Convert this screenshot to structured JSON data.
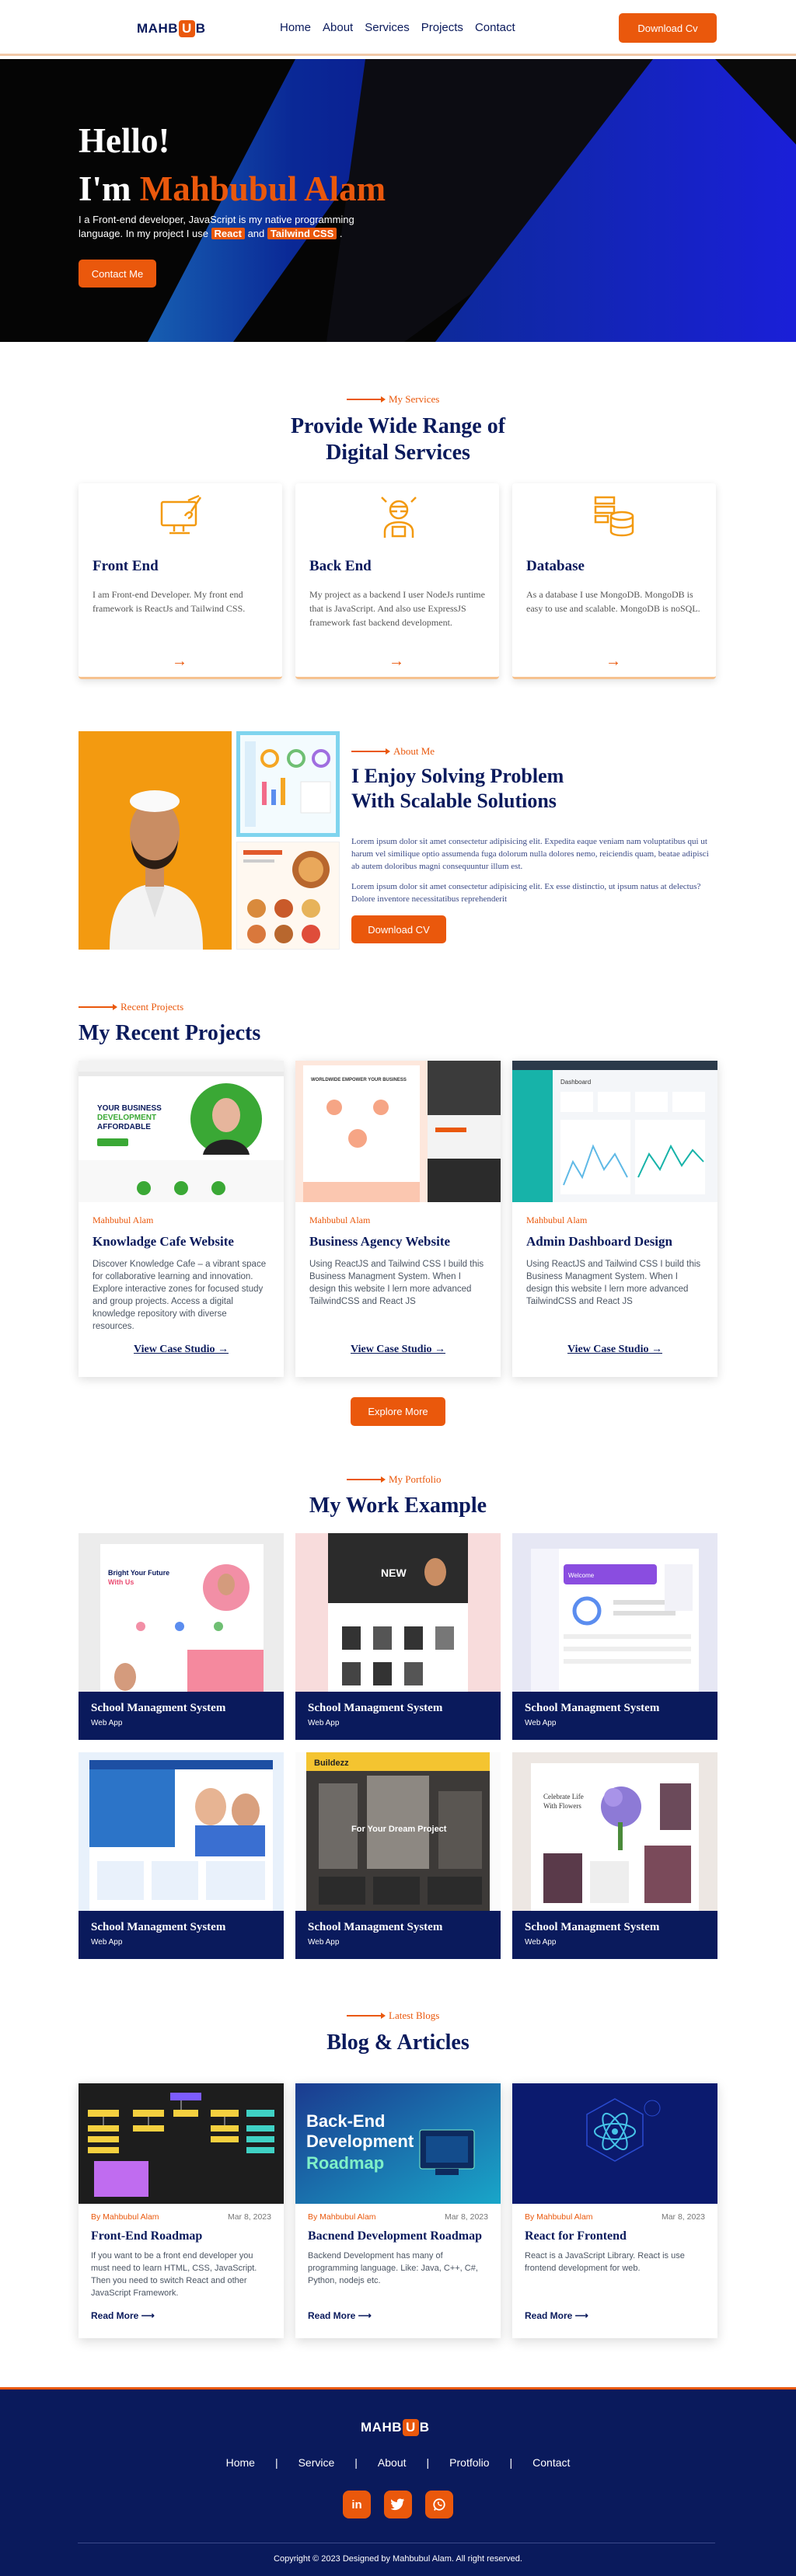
{
  "nav": {
    "logo_pre": "MAHB",
    "logo_mid": "U",
    "logo_post": "B",
    "items": [
      "Home",
      "About",
      "Services",
      "Projects",
      "Contact"
    ],
    "cv_button": "Download Cv"
  },
  "hero": {
    "line1": "Hello!",
    "line2_prefix": "I'm ",
    "name": "Mahbubul Alam",
    "desc_a": "I a Front-end developer, JavaScript is my native programming language. In my project I use ",
    "tag1": "React",
    "desc_and": " and ",
    "tag2": "Tailwind CSS",
    "desc_end": " .",
    "contact_button": "Contact Me"
  },
  "services": {
    "kicker": "My Services",
    "title_line1": "Provide Wide Range of",
    "title_line2": "Digital Services",
    "cards": [
      {
        "title": "Front End",
        "text": "I am Front-end Developer. My front end framework is ReactJs and Tailwind CSS.",
        "icon": "monitor-brush-icon"
      },
      {
        "title": "Back End",
        "text": "My project as a backend I user NodeJs runtime that is JavaScript. And also use ExpressJS framework fast backend development.",
        "icon": "developer-icon"
      },
      {
        "title": "Database",
        "text": "As a database I use MongoDB. MongoDB is easy to use and scalable. MongoDB is noSQL.",
        "icon": "database-icon"
      }
    ],
    "arrow": "→"
  },
  "about": {
    "kicker": "About Me",
    "title_line1": "I Enjoy Solving Problem",
    "title_line2": "With Scalable Solutions",
    "p1": "Lorem ipsum dolor sit amet consectetur adipisicing elit. Expedita eaque veniam nam voluptatibus qui ut harum vel similique optio assumenda fuga dolorum nulla dolores nemo, reiciendis quam, beatae adipisci ab autem doloribus magni consequuntur illum est.",
    "p2": "Lorem ipsum dolor sit amet consectetur adipisicing elit. Ex esse distinctio, ut ipsum natus at delectus? Dolore inventore necessitatibus reprehenderit",
    "cv_button": "Download CV"
  },
  "projects": {
    "kicker": "Recent Projects",
    "title": "My Recent Projects",
    "items": [
      {
        "by": "Mahbubul Alam",
        "title": "Knowladge Cafe Website",
        "text": "Discover Knowledge Cafe – a vibrant space for collaborative learning and innovation. Explore interactive zones for focused study and group projects. Access a digital knowledge repository with diverse resources.",
        "link": "View Case Studio →",
        "shot_heading": "YOUR BUSINESS DEVELOPMENT AFFORDABLE"
      },
      {
        "by": "Mahbubul Alam",
        "title": "Business Agency Website",
        "text": "Using ReactJS and Tailwind CSS I build this Business Managment System. When I design this website I lern more advanced TailwindCSS and React JS",
        "link": "View Case Studio →",
        "shot_heading": "WORLDWIDE EMPOWER YOUR BUSINESS WITH OUR SERVICES"
      },
      {
        "by": "Mahbubul Alam",
        "title": "Admin Dashboard Design",
        "text": "Using ReactJS and Tailwind CSS I build this Business Managment System. When I design this website I lern more advanced TailwindCSS and React JS",
        "link": "View Case Studio →",
        "shot_heading": "Dashboard"
      }
    ],
    "explore_button": "Explore More"
  },
  "portfolio": {
    "kicker": "My Portfolio",
    "title": "My Work Example",
    "items": [
      {
        "title": "School Managment System",
        "sub": "Web App",
        "shot_text": "Bright Your Future With Us"
      },
      {
        "title": "School Managment System",
        "sub": "Web App",
        "shot_text": "NEW"
      },
      {
        "title": "School Managment System",
        "sub": "Web App",
        "shot_text": "Welcome"
      },
      {
        "title": "School Managment System",
        "sub": "Web App",
        "shot_text": ""
      },
      {
        "title": "School Managment System",
        "sub": "Web App",
        "shot_text": "For Your Dream Project"
      },
      {
        "title": "School Managment System",
        "sub": "Web App",
        "shot_text": "Celebrate Life With Flowers"
      }
    ]
  },
  "blogs": {
    "kicker": "Latest Blogs",
    "title": "Blog & Articles",
    "items": [
      {
        "by": "By Mahbubul Alam",
        "date": "Mar 8, 2023",
        "title": "Front-End Roadmap",
        "text": "If you want to be a front end developer you must need to learn HTML, CSS, JavaScript. Then you need to switch React and other JavaScript Framework.",
        "link": "Read More ⟶"
      },
      {
        "by": "By Mahbubul Alam",
        "date": "Mar 8, 2023",
        "title": "Bacnend Development Roadmap",
        "text": "Backend Development has many of programming language. Like: Java, C++, C#, Python, nodejs etc.",
        "link": "Read More ⟶",
        "shot_text1": "Back-End",
        "shot_text2": "Development",
        "shot_text3": "Roadmap"
      },
      {
        "by": "By Mahbubul Alam",
        "date": "Mar 8, 2023",
        "title": "React for Frontend",
        "text": "React is a JavaScript Library. React is use frontend development for web.",
        "link": "Read More ⟶"
      }
    ]
  },
  "footer": {
    "nav": [
      "Home",
      "Service",
      "About",
      "Protfolio",
      "Contact"
    ],
    "sep": "|",
    "social": [
      {
        "label": "in",
        "icon": "linkedin-icon"
      },
      {
        "label": "t",
        "icon": "twitter-icon"
      },
      {
        "label": "w",
        "icon": "whatsapp-icon"
      }
    ],
    "copyright": "Copyright © 2023 Designed by Mahbubul Alam. All right reserved."
  },
  "colors": {
    "accent": "#ea580c",
    "navy": "#0a1a5c"
  }
}
